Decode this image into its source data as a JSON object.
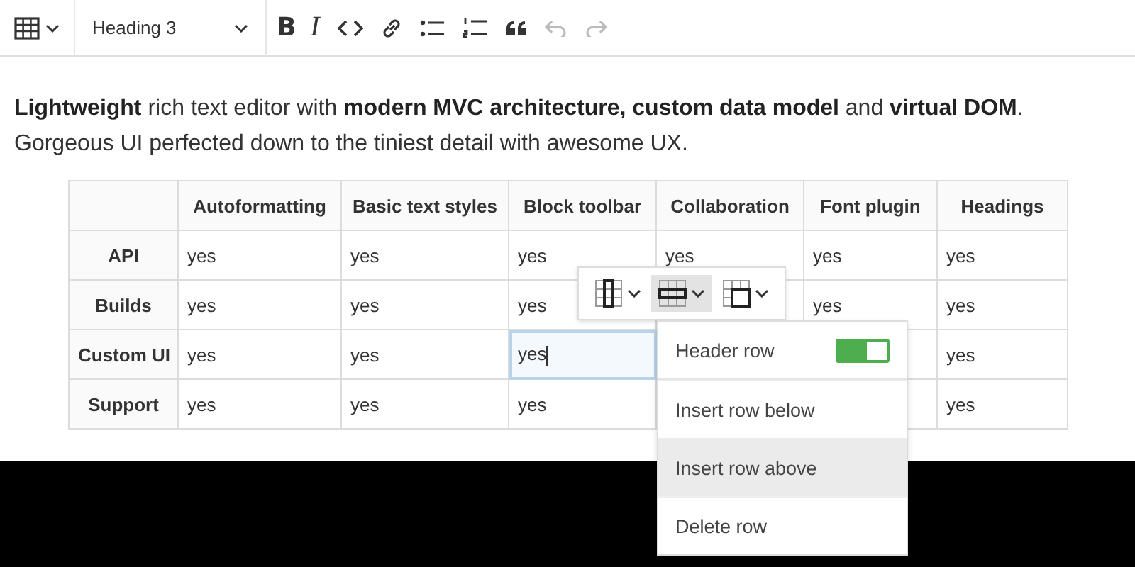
{
  "toolbar": {
    "items": [
      {
        "kind": "table",
        "disabled": false
      },
      {
        "kind": "heading",
        "label": "Heading 3",
        "disabled": false
      },
      {
        "kind": "bold",
        "label": "B",
        "disabled": false
      },
      {
        "kind": "italic",
        "label": "I",
        "disabled": false
      },
      {
        "kind": "code",
        "disabled": false
      },
      {
        "kind": "link",
        "disabled": false
      },
      {
        "kind": "bulleted-list",
        "disabled": false
      },
      {
        "kind": "numbered-list",
        "disabled": false
      },
      {
        "kind": "quote",
        "disabled": false
      },
      {
        "kind": "undo",
        "disabled": true
      },
      {
        "kind": "redo",
        "disabled": true
      }
    ]
  },
  "paragraphs": [
    "**Lightweight** rich text editor with **modern MVC architecture, custom data model** and **virtual DOM**.",
    "Gorgeous UI perfected down to the tiniest detail with awesome UX."
  ],
  "table": {
    "columns": [
      "",
      "Autoformatting",
      "Basic text styles",
      "Block toolbar",
      "Collaboration",
      "Font plugin",
      "Headings"
    ],
    "rows": [
      {
        "cells": [
          {
            "text": "API",
            "selected": false
          },
          {
            "text": "yes",
            "selected": false
          },
          {
            "text": "yes",
            "selected": false
          },
          {
            "text": "yes",
            "selected": false
          },
          {
            "text": "yes",
            "selected": false
          },
          {
            "text": "yes",
            "selected": false
          },
          {
            "text": "yes",
            "selected": false
          }
        ]
      },
      {
        "cells": [
          {
            "text": "Builds",
            "selected": false
          },
          {
            "text": "yes",
            "selected": false
          },
          {
            "text": "yes",
            "selected": false
          },
          {
            "text": "yes",
            "selected": false
          },
          null,
          {
            "text": "yes",
            "selected": false
          },
          {
            "text": "yes",
            "selected": false
          }
        ]
      },
      {
        "cells": [
          {
            "text": "Custom UI",
            "selected": false
          },
          {
            "text": "yes",
            "selected": false
          },
          {
            "text": "yes",
            "selected": false
          },
          {
            "text": "yes",
            "selected": true
          },
          null,
          null,
          {
            "text": "yes",
            "selected": false
          }
        ]
      },
      {
        "cells": [
          {
            "text": "Support",
            "selected": false
          },
          {
            "text": "yes",
            "selected": false
          },
          {
            "text": "yes",
            "selected": false
          },
          {
            "text": "yes",
            "selected": false
          },
          null,
          null,
          {
            "text": "yes",
            "selected": false
          }
        ]
      }
    ]
  },
  "table_toolbar": {
    "buttons": [
      {
        "kind": "column",
        "selected": false
      },
      {
        "kind": "row",
        "selected": true
      },
      {
        "kind": "merge",
        "selected": false
      }
    ]
  },
  "row_menu": {
    "items": [
      {
        "kind": "toggle",
        "label": "Header row",
        "on": true,
        "hovered": false
      },
      {
        "kind": "action",
        "label": "Insert row below",
        "hovered": false
      },
      {
        "kind": "action",
        "label": "Insert row above",
        "hovered": true
      },
      {
        "kind": "action",
        "label": "Delete row",
        "hovered": false
      }
    ]
  }
}
